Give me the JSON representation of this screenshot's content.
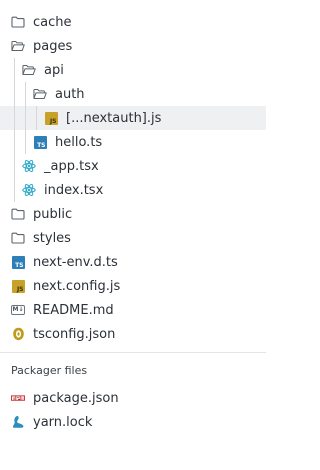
{
  "file_tree": [
    {
      "label": "cache",
      "icon": "folder-icon"
    },
    {
      "label": "pages",
      "icon": "folder-open-icon"
    },
    {
      "label": "api",
      "icon": "folder-open-icon"
    },
    {
      "label": "auth",
      "icon": "folder-open-icon"
    },
    {
      "label": "[...nextauth].js",
      "icon": "javascript-file-icon",
      "badge": "JS"
    },
    {
      "label": "hello.ts",
      "icon": "typescript-file-icon",
      "badge": "TS"
    },
    {
      "label": "_app.tsx",
      "icon": "react-file-icon"
    },
    {
      "label": "index.tsx",
      "icon": "react-file-icon"
    },
    {
      "label": "public",
      "icon": "folder-icon"
    },
    {
      "label": "styles",
      "icon": "folder-icon"
    },
    {
      "label": "next-env.d.ts",
      "icon": "typescript-file-icon",
      "badge": "TS"
    },
    {
      "label": "next.config.js",
      "icon": "javascript-file-icon",
      "badge": "JS"
    },
    {
      "label": "README.md",
      "icon": "markdown-file-icon",
      "badge": "M↓"
    },
    {
      "label": "tsconfig.json",
      "icon": "tsconfig-file-icon"
    }
  ],
  "packager": {
    "title": "Packager files",
    "files": [
      {
        "label": "package.json",
        "icon": "npm-icon"
      },
      {
        "label": "yarn.lock",
        "icon": "yarn-icon"
      }
    ]
  },
  "colors": {
    "selected_row": "#eef0f2",
    "js_badge": "#c8a12a",
    "ts_badge": "#2e7fb8",
    "react": "#2aa7c9",
    "npm": "#c12127",
    "yarn": "#2c8ebb"
  }
}
